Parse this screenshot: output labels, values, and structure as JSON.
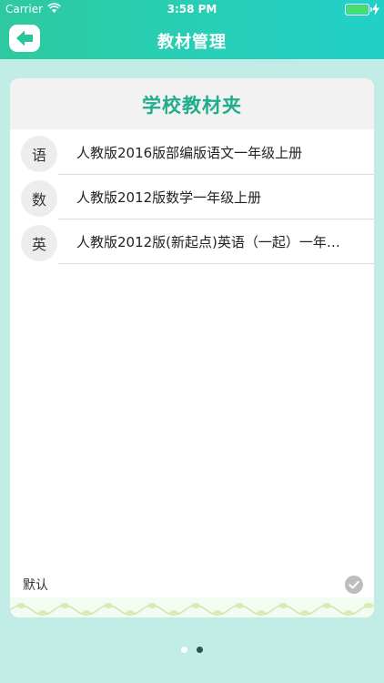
{
  "status_bar": {
    "carrier": "Carrier",
    "time": "3:58 PM"
  },
  "nav": {
    "title": "教材管理"
  },
  "card": {
    "title": "学校教材夹",
    "items": [
      {
        "subject": "语",
        "name": "人教版2016版部编版语文一年级上册"
      },
      {
        "subject": "数",
        "name": "人教版2012版数学一年级上册"
      },
      {
        "subject": "英",
        "name": "人教版2012版(新起点)英语（一起）一年…"
      }
    ],
    "default_label": "默认"
  },
  "colors": {
    "header_start": "#2ec9a0",
    "header_end": "#22d0c8",
    "accent": "#1fad8c",
    "background": "#c2ede6"
  },
  "page_indicator": {
    "count": 2,
    "active_index": 1
  }
}
